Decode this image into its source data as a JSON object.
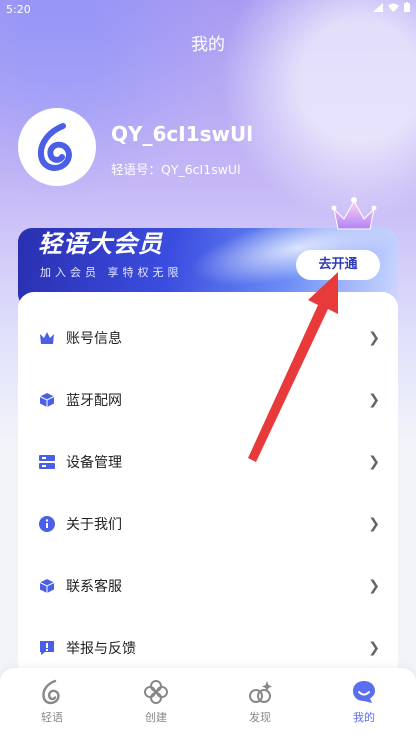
{
  "status_bar": {
    "time": "5:20"
  },
  "header": {
    "title": "我的"
  },
  "profile": {
    "username": "QY_6cI1swUl",
    "account_id": "轻语号：QY_6cI1swUl"
  },
  "vip": {
    "title": "轻语大会员",
    "subtitle": "加入会员 享特权无限",
    "button_label": "去开通"
  },
  "menu": {
    "items": [
      {
        "label": "账号信息",
        "icon": "crown-icon"
      },
      {
        "label": "蓝牙配网",
        "icon": "cube-icon"
      },
      {
        "label": "设备管理",
        "icon": "server-icon"
      },
      {
        "label": "关于我们",
        "icon": "info-icon"
      },
      {
        "label": "联系客服",
        "icon": "box-icon"
      },
      {
        "label": "举报与反馈",
        "icon": "alert-icon"
      }
    ]
  },
  "tabbar": {
    "tabs": [
      {
        "label": "轻语",
        "icon": "swirl-icon",
        "active": false
      },
      {
        "label": "创建",
        "icon": "flower-icon",
        "active": false
      },
      {
        "label": "发现",
        "icon": "discover-icon",
        "active": false
      },
      {
        "label": "我的",
        "icon": "chat-face-icon",
        "active": true
      }
    ]
  },
  "colors": {
    "accent": "#5b6ef0",
    "vip_dark": "#2a2fb0",
    "arrow_red": "#e83a3a"
  }
}
